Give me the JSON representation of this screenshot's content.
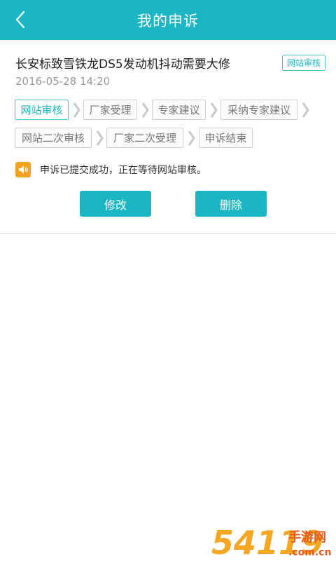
{
  "header": {
    "title": "我的申诉"
  },
  "complaint": {
    "title": "长安标致雪铁龙DS5发动机抖动需要大修",
    "status_tag": "网站审核",
    "date": "2016-05-28 14:20"
  },
  "progress": {
    "steps": [
      "网站审核",
      "厂家受理",
      "专家建议",
      "采纳专家建议",
      "网站二次审核",
      "厂家二次受理",
      "申诉结束"
    ],
    "current_step": 0
  },
  "notice": {
    "text": "申诉已提交成功，正在等待网站审核。"
  },
  "actions": {
    "edit_label": "修改",
    "delete_label": "删除"
  },
  "watermark": {
    "main": "54119",
    "site": "手游网",
    "domain": ".com.cn"
  },
  "colors": {
    "primary": "#1bb5c4",
    "speaker": "#f3a21f",
    "watermark": "#f5a623"
  }
}
